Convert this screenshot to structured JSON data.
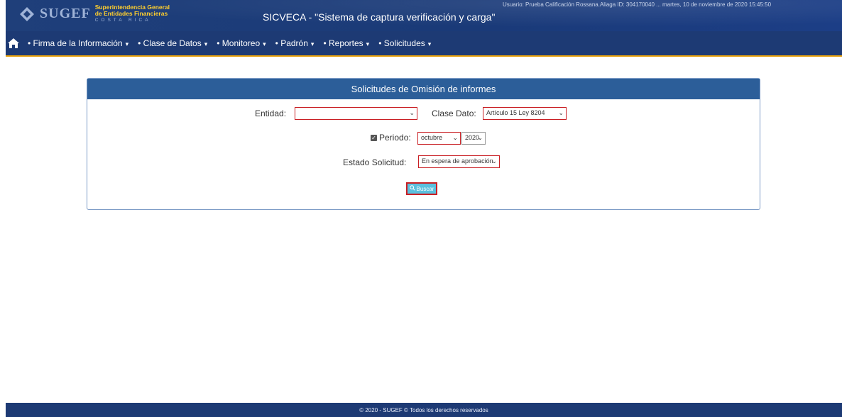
{
  "header": {
    "logo_brand": "SUGEF",
    "logo_line1": "Superintendencia General",
    "logo_line2": "de Entidades Financieras",
    "logo_line3": "COSTA RICA",
    "app_title": "SICVECA - \"Sistema de captura verificación y carga\"",
    "user_info": "Usuario: Prueba Calificación Rossana.Aliaga  ID: 304170040  ...   martes, 10 de noviembre de 2020 15:45:50"
  },
  "nav": {
    "items": [
      {
        "label": "• Firma de la Información"
      },
      {
        "label": "• Clase de Datos"
      },
      {
        "label": "• Monitoreo"
      },
      {
        "label": "• Padrón"
      },
      {
        "label": "• Reportes"
      },
      {
        "label": "• Solicitudes"
      }
    ],
    "caret": "▾"
  },
  "panel": {
    "title": "Solicitudes de Omisión de informes",
    "entidad_label": "Entidad:",
    "entidad_value": "",
    "clase_dato_label": "Clase Dato:",
    "clase_dato_value": "Artículo 15 Ley 8204",
    "periodo_label": "Periodo:",
    "periodo_checked": true,
    "periodo_month": "octubre",
    "periodo_year": "2020",
    "estado_label": "Estado Solicitud:",
    "estado_value": "En espera de aprobación",
    "buscar_label": "Buscar"
  },
  "footer": {
    "text": "© 2020 - SUGEF © Todos los derechos reservados"
  },
  "colors": {
    "header_bg": "#1f3f7a",
    "nav_bg": "#1d3a74",
    "nav_border": "#e9a10b",
    "panel_head": "#2c5e99",
    "highlight": "#c91f24",
    "button": "#5bc0de"
  }
}
